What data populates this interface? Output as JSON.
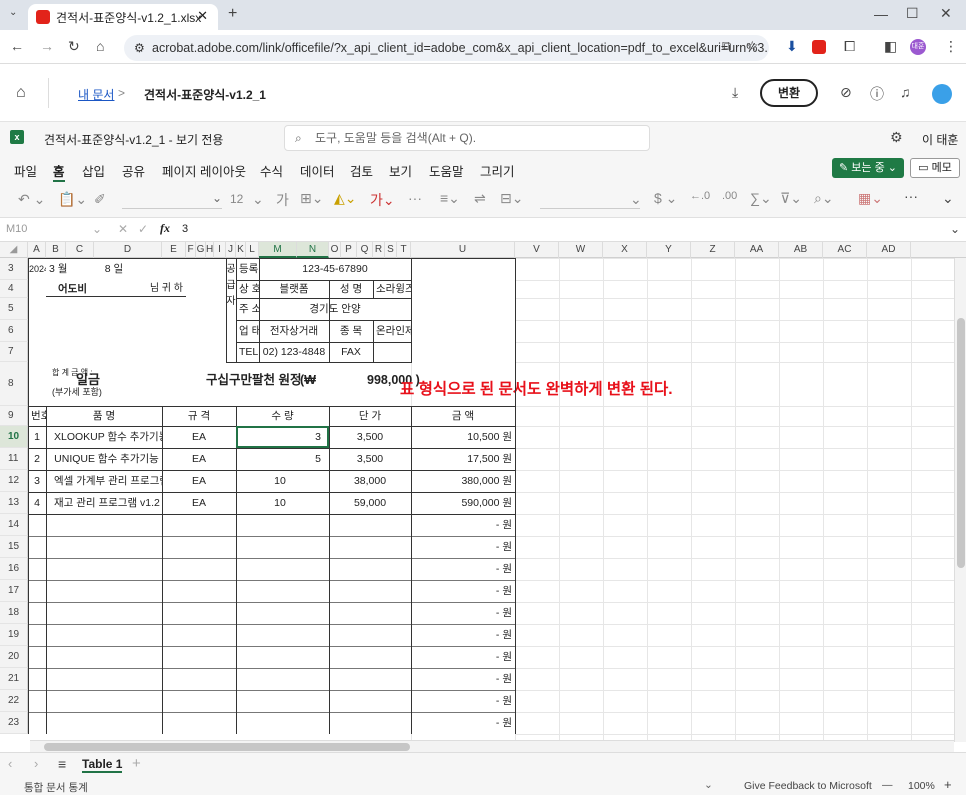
{
  "browser": {
    "tab_title": "견적서-표준양식-v1.2_1.xlsx",
    "url": "acrobat.adobe.com/link/officefile/?x_api_client_id=adobe_com&x_api_client_location=pdf_to_excel&uri=urn%3...",
    "profile": "대훈"
  },
  "acrobat": {
    "breadcrumb_home": "내 문서",
    "breadcrumb_sep": ">",
    "title": "견적서-표준양식-v1.2_1",
    "convert_label": "변환"
  },
  "excel": {
    "file_title": "견적서-표준양식-v1.2_1 - 보기 전용",
    "search_placeholder": "도구, 도움말 등을 검색(Alt + Q).",
    "user": "이 태훈",
    "menu": [
      "파일",
      "홈",
      "삽입",
      "공유",
      "페이지 레이아웃",
      "수식",
      "데이터",
      "검토",
      "보기",
      "도움말",
      "그리기"
    ],
    "view_mode": "보는 중",
    "memo": "메모",
    "font_size": "12",
    "cell_ref": "M10",
    "formula": "3"
  },
  "columns": [
    "A",
    "B",
    "C",
    "D",
    "E",
    "F",
    "G",
    "H",
    "I",
    "J",
    "K",
    "L",
    "M",
    "N",
    "O",
    "P",
    "Q",
    "R",
    "S",
    "T",
    "U",
    "V",
    "W",
    "X",
    "Y",
    "Z",
    "AA",
    "AB",
    "AC",
    "AD"
  ],
  "rows": [
    "3",
    "4",
    "5",
    "6",
    "7",
    "8",
    "9",
    "10",
    "11",
    "12",
    "13",
    "14",
    "15",
    "16",
    "17",
    "18",
    "19",
    "20",
    "21",
    "22",
    "23"
  ],
  "quote": {
    "year": "2024 년",
    "month": "3 월",
    "day": "8 일",
    "recipient": "어도비",
    "honorific": "님 귀 하",
    "supplier_vertical": [
      "공",
      "급",
      "자"
    ],
    "reg_label": "등록번호",
    "reg_no": "123-45-67890",
    "name_label": "상 호",
    "company": "블랫폼",
    "rep_label": "성 명",
    "rep": "소라윙즈",
    "addr_label": "주 소",
    "addr": "경기도 안양",
    "biz_label": "업 태",
    "biz": "전자상거래",
    "item_label": "종 목",
    "item": "온라인제품",
    "tel_label": "TEL",
    "tel": "02) 123-4848",
    "fax_label": "FAX",
    "total_label": "합 계 금 액 :",
    "total_note": "(부가세 포함)",
    "total_word": "일금",
    "total_korean": "구십구만팔천 원정",
    "total_open": "(₩",
    "total_num": "998,000 )",
    "headers": [
      "번호",
      "품   명",
      "규 격",
      "수 량",
      "단 가",
      "금   액"
    ],
    "items": [
      {
        "no": "1",
        "name": "XLOOKUP 함수 추가기능",
        "unit": "EA",
        "qty": "3",
        "price": "3,500",
        "amount": "10,500 원"
      },
      {
        "no": "2",
        "name": "UNIQUE 함수 추가기능",
        "unit": "EA",
        "qty": "5",
        "price": "3,500",
        "amount": "17,500 원"
      },
      {
        "no": "3",
        "name": "엑셀 가계부 관리 프로그램",
        "unit": "EA",
        "qty": "10",
        "price": "38,000",
        "amount": "380,000 원"
      },
      {
        "no": "4",
        "name": "재고 관리 프로그램 v1.2",
        "unit": "EA",
        "qty": "10",
        "price": "59,000",
        "amount": "590,000 원"
      }
    ],
    "empty_amount": "- 원"
  },
  "annotation": "표 형식으로 된 문서도 완벽하게 변환 된다.",
  "sheet_tab": "Table 1",
  "status": {
    "left": "통합 문서 통계",
    "feedback": "Give Feedback to Microsoft",
    "zoom": "100%"
  }
}
